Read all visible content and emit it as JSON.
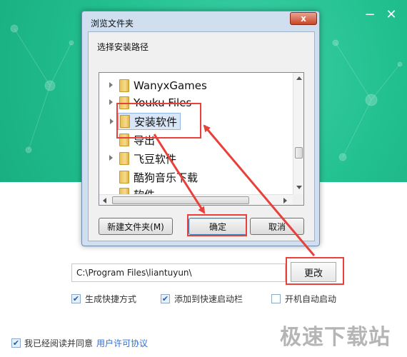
{
  "installer": {
    "install_path": "C:\\Program Files\\liantuyun\\",
    "change_button": "更改",
    "options": [
      {
        "label": "生成快捷方式",
        "checked": true
      },
      {
        "label": "添加到快速启动栏",
        "checked": true
      },
      {
        "label": "开机自动启动",
        "checked": false
      }
    ],
    "agree_prefix": "我已经阅读并同意",
    "agree_link": "用户许可协议",
    "agree_checked": true,
    "window_controls": {
      "minimize": "−",
      "close": "✕"
    },
    "accent_color": "#22c08f"
  },
  "dialog": {
    "title": "浏览文件夹",
    "close_symbol": "x",
    "prompt": "选择安装路径",
    "folders": [
      {
        "name": "WanyxGames",
        "expandable": true,
        "selected": false
      },
      {
        "name": "Youku Files",
        "expandable": true,
        "selected": false
      },
      {
        "name": "安装软件",
        "expandable": true,
        "selected": true
      },
      {
        "name": "导出",
        "expandable": false,
        "selected": false
      },
      {
        "name": "飞豆软件",
        "expandable": true,
        "selected": false
      },
      {
        "name": "酷狗音乐下载",
        "expandable": false,
        "selected": false
      },
      {
        "name": "软件",
        "expandable": false,
        "selected": false
      }
    ],
    "buttons": {
      "new_folder": "新建文件夹(M)",
      "ok": "确定",
      "cancel": "取消"
    }
  },
  "watermark": "极速下载站",
  "annotation_color": "#e8413b"
}
